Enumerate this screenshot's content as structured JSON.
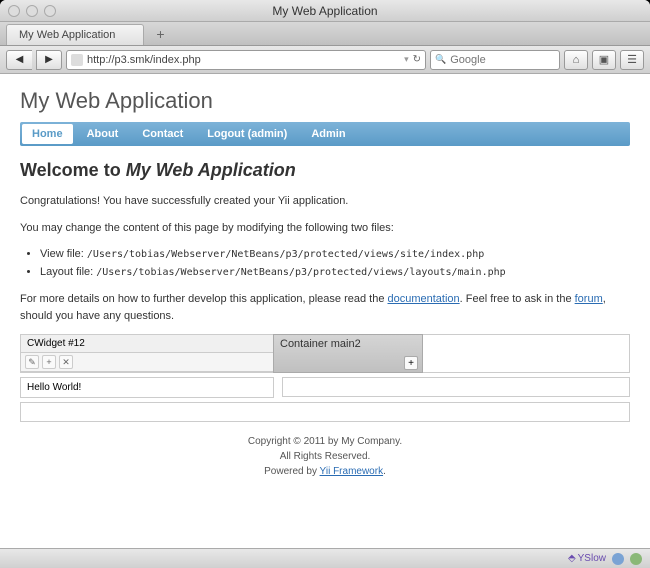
{
  "window": {
    "title": "My Web Application"
  },
  "tab": {
    "label": "My Web Application"
  },
  "nav": {
    "url": "http://p3.smk/index.php",
    "search_placeholder": "Google"
  },
  "app": {
    "title": "My Web Application"
  },
  "menu": {
    "home": "Home",
    "about": "About",
    "contact": "Contact",
    "logout": "Logout (admin)",
    "admin": "Admin"
  },
  "page": {
    "welcome_prefix": "Welcome to ",
    "welcome_app": "My Web Application",
    "congrats": "Congratulations! You have successfully created your Yii application.",
    "modify_intro": "You may change the content of this page by modifying the following two files:",
    "view_label": "View file: ",
    "view_path": "/Users/tobias/Webserver/NetBeans/p3/protected/views/site/index.php",
    "layout_label": "Layout file: ",
    "layout_path": "/Users/tobias/Webserver/NetBeans/p3/protected/views/layouts/main.php",
    "more_prefix": "For more details on how to further develop this application, please read the ",
    "doc_link": "documentation",
    "more_mid": ". Feel free to ask in the ",
    "forum_link": "forum",
    "more_suffix": ", should you have any questions."
  },
  "widgets": {
    "cwidget_title": "CWidget #12",
    "container2_title": "Container main2",
    "hello": "Hello World!"
  },
  "footer": {
    "copyright": "Copyright © 2011 by My Company.",
    "rights": "All Rights Reserved.",
    "powered_prefix": "Powered by ",
    "yii_link": "Yii Framework",
    "powered_suffix": "."
  },
  "status": {
    "yslow": "YSlow"
  }
}
